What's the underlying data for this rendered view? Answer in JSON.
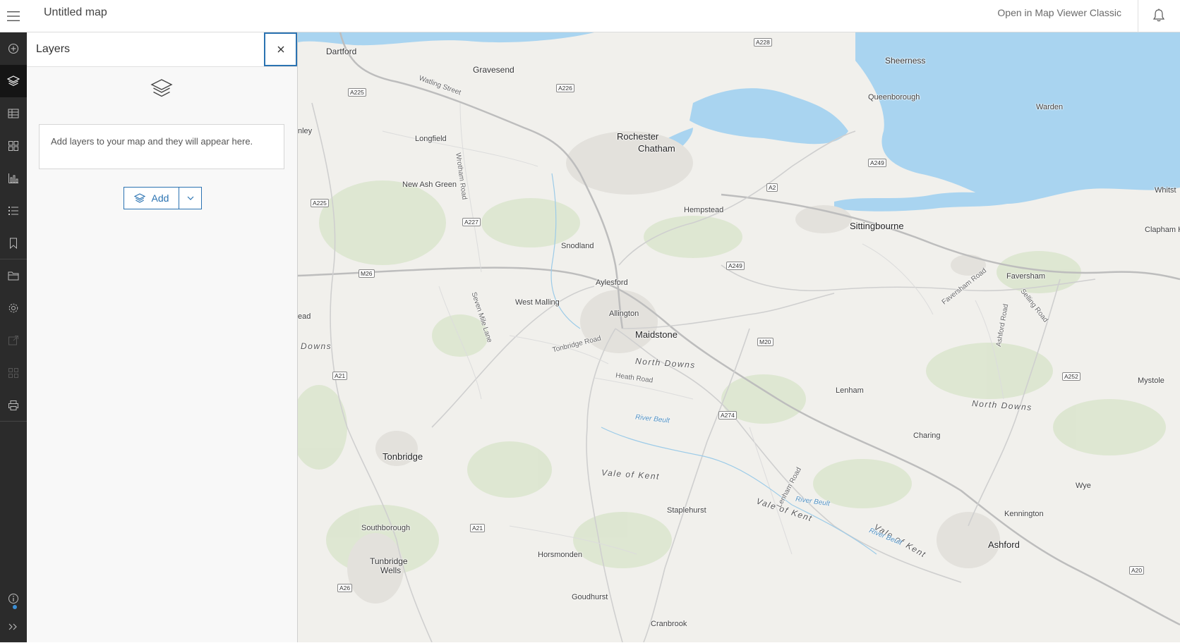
{
  "header": {
    "title": "Untitled map",
    "open_classic": "Open in Map Viewer Classic"
  },
  "actionbar": {
    "items": [
      {
        "icon": "add-circle-icon"
      },
      {
        "icon": "layers-icon",
        "active": true
      },
      {
        "icon": "table-icon"
      },
      {
        "icon": "basemap-icon"
      },
      {
        "icon": "chart-icon"
      },
      {
        "icon": "legend-icon"
      },
      {
        "icon": "bookmark-icon"
      },
      {
        "icon": "folder-icon"
      },
      {
        "icon": "settings-icon"
      },
      {
        "icon": "share-icon"
      },
      {
        "icon": "apps-icon"
      },
      {
        "icon": "print-icon"
      },
      {
        "icon": "info-icon"
      },
      {
        "icon": "expand-icon"
      }
    ]
  },
  "panel": {
    "title": "Layers",
    "empty_message": "Add layers to your map and they will appear here.",
    "add_label": "Add"
  },
  "map": {
    "places": [
      {
        "name": "Dartford"
      },
      {
        "name": "Gravesend"
      },
      {
        "name": "Sheerness"
      },
      {
        "name": "Queenborough"
      },
      {
        "name": "Warden"
      },
      {
        "name": "Rochester"
      },
      {
        "name": "Chatham"
      },
      {
        "name": "Longfield"
      },
      {
        "name": "New Ash Green"
      },
      {
        "name": "Hempstead"
      },
      {
        "name": "Sittingbourne"
      },
      {
        "name": "Snodland"
      },
      {
        "name": "Aylesford"
      },
      {
        "name": "West Malling"
      },
      {
        "name": "Allington"
      },
      {
        "name": "Maidstone"
      },
      {
        "name": "Faversham"
      },
      {
        "name": "Lenham"
      },
      {
        "name": "Charing"
      },
      {
        "name": "Mystole"
      },
      {
        "name": "Tonbridge"
      },
      {
        "name": "Staplehurst"
      },
      {
        "name": "Southborough"
      },
      {
        "name": "Tunbridge"
      },
      {
        "name": "Wells"
      },
      {
        "name": "Horsmonden"
      },
      {
        "name": "Goudhurst"
      },
      {
        "name": "Cranbrook"
      },
      {
        "name": "Ashford"
      },
      {
        "name": "Kennington"
      },
      {
        "name": "Wye"
      },
      {
        "name": "Whitst"
      },
      {
        "name": "Clapham H"
      },
      {
        "name": "nley"
      },
      {
        "name": "ead"
      }
    ],
    "regions": [
      "North Downs",
      "North Downs",
      "Vale of Kent",
      "Vale of Kent",
      "Vale of Kent",
      "Downs"
    ],
    "roads": [
      "Watling Street",
      "Wrotham Road",
      "Seven Mile Lane",
      "Tonbridge Road",
      "Heath Road",
      "Lenham Road",
      "Faversham Road",
      "Ashford Road",
      "Selling Road"
    ],
    "rivers": [
      "River Beult",
      "River Beult",
      "River Beult"
    ],
    "shields": [
      "A228",
      "A225",
      "A226",
      "A249",
      "A2",
      "A225",
      "A227",
      "M26",
      "A249",
      "M20",
      "A21",
      "A274",
      "A252",
      "A21",
      "A26",
      "A20"
    ]
  }
}
